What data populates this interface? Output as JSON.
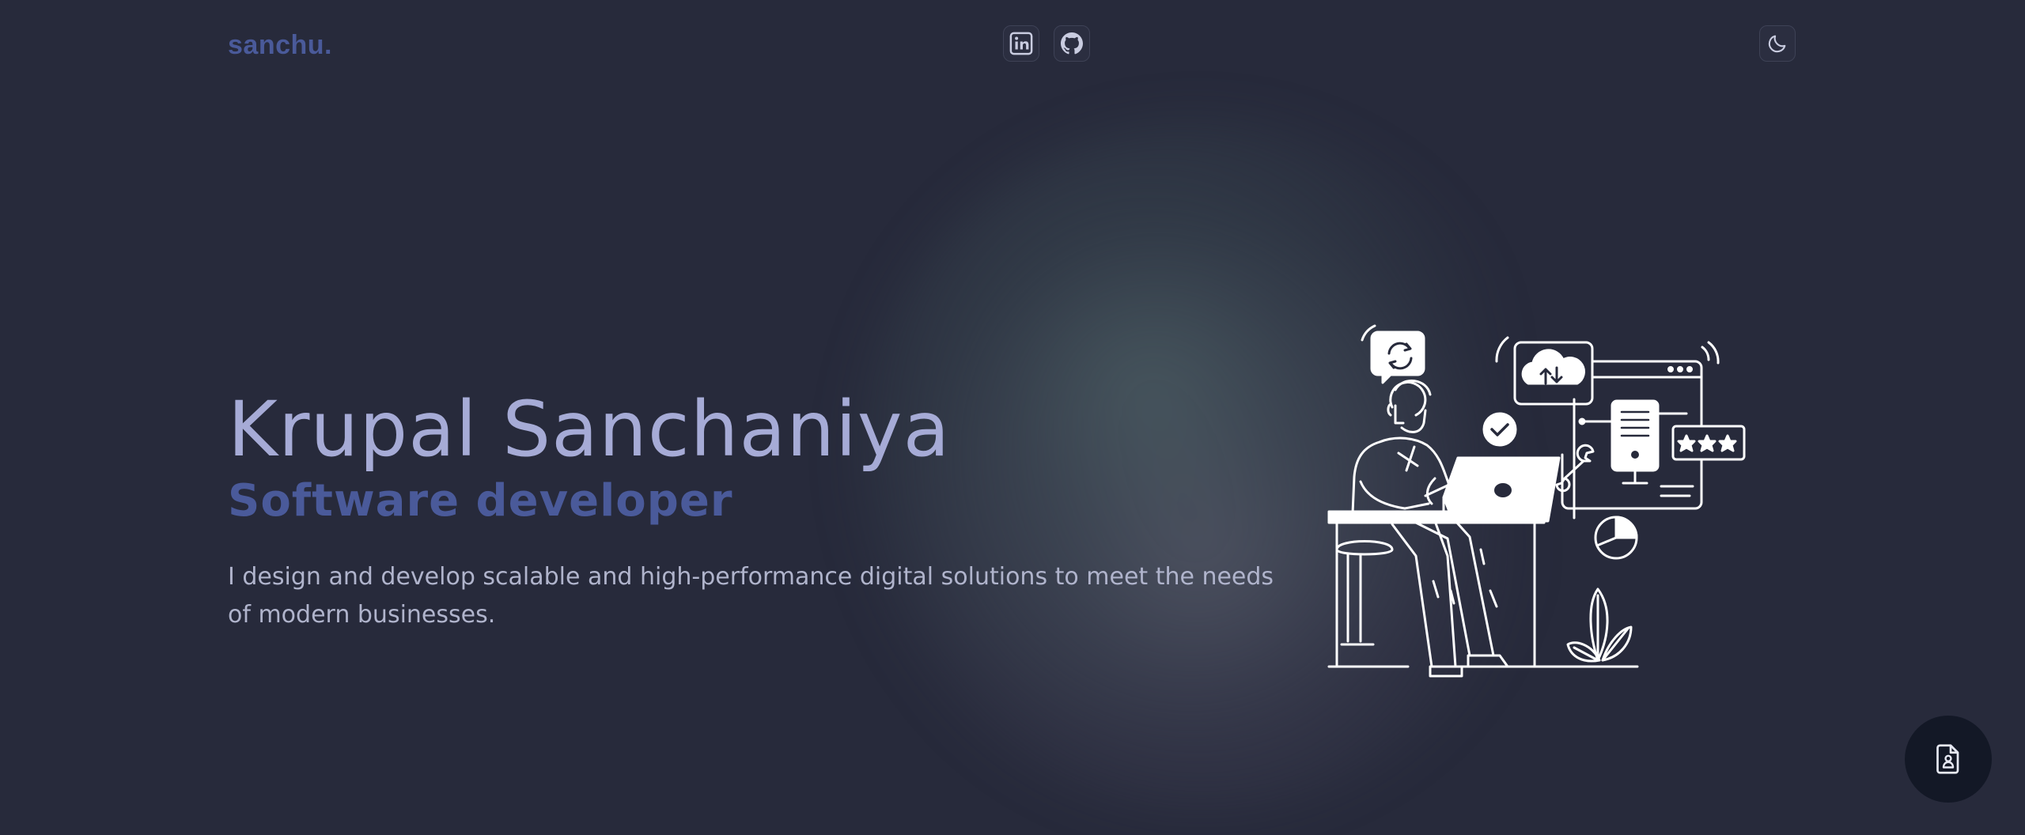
{
  "header": {
    "logo": "sanchu.",
    "social": [
      {
        "icon": "linkedin-icon"
      },
      {
        "icon": "github-icon"
      }
    ],
    "theme_toggle_icon": "moon-icon"
  },
  "hero": {
    "name": "Krupal Sanchaniya",
    "role": "Software developer",
    "description": "I design and develop scalable and high-performance digital solutions to meet the needs of modern businesses.",
    "illustration": "developer-at-laptop-illustration"
  },
  "fab": {
    "icon": "resume-file-icon"
  },
  "colors": {
    "background": "#272a3b",
    "accent": "#4a5a9a",
    "name_text": "#a6abd6",
    "body_text": "#b0b4cc",
    "fab_background": "#131826"
  }
}
